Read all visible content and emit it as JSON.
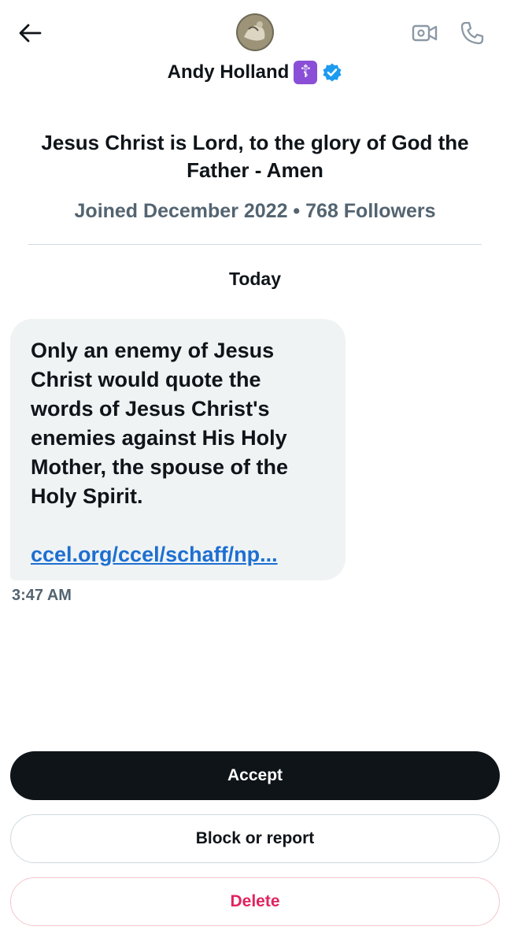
{
  "header": {
    "display_name": "Andy Holland",
    "name_emoji": "☦",
    "icons": {
      "back": "arrow-left-icon",
      "video": "video-camera-icon",
      "call": "phone-icon",
      "verified": "verified-badge-icon"
    },
    "accent_color": "#1d9bf0"
  },
  "profile": {
    "bio": "Jesus Christ is Lord, to the glory of God the Father - Amen",
    "meta": "Joined December 2022 • 768 Followers"
  },
  "conversation": {
    "date_separator": "Today",
    "messages": [
      {
        "text": "Only an enemy of Jesus Christ would quote the words of Jesus Christ's enemies against His Holy Mother, the spouse of the Holy Spirit.",
        "link": "ccel.org/ccel/schaff/np...",
        "time": "3:47 AM"
      }
    ]
  },
  "actions": {
    "accept": "Accept",
    "block_or_report": "Block or report",
    "delete": "Delete",
    "delete_color": "#e0245e"
  }
}
